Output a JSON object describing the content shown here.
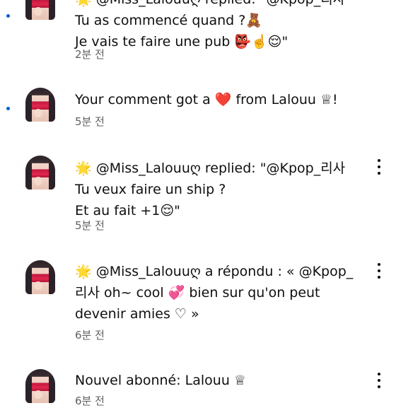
{
  "notifications": [
    {
      "lines": [
        "🌟 @Miss_Lalouuღ replied: \"@Kpop_리사",
        "Tu as commencé quand ?🧸",
        "Je vais te faire une pub 👺☝️😌\""
      ],
      "time": "2분 전",
      "unread": true
    },
    {
      "lines": [
        "Your comment got a ❤️ from Lalouu ♕!"
      ],
      "time": "5분 전",
      "unread": true
    },
    {
      "lines": [
        "🌟 @Miss_Lalouuღ replied: \"@Kpop_리사",
        "Tu veux faire un ship ?",
        "Et au fait +1😌\""
      ],
      "time": "5분 전",
      "unread": false
    },
    {
      "lines": [
        "🌟 @Miss_Lalouuღ a répondu : « @Kpop_",
        "리사 oh~ cool 💞 bien sur qu'on peut",
        "devenir amies ♡ »"
      ],
      "time": "6분 전",
      "unread": false
    },
    {
      "lines": [
        "Nouvel abonné: Lalouu ♕"
      ],
      "time": "6분 전",
      "unread": false
    }
  ]
}
